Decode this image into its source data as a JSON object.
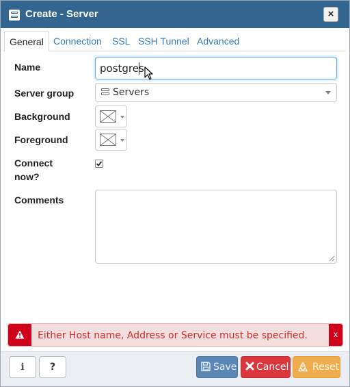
{
  "window": {
    "title": "Create - Server",
    "close_label": "×"
  },
  "tabs": [
    {
      "label": "General",
      "active": true
    },
    {
      "label": "Connection",
      "active": false
    },
    {
      "label": "SSL",
      "active": false
    },
    {
      "label": "SSH Tunnel",
      "active": false
    },
    {
      "label": "Advanced",
      "active": false
    }
  ],
  "form": {
    "name": {
      "label": "Name",
      "value": "postgres"
    },
    "server_group": {
      "label": "Server group",
      "selected": "Servers"
    },
    "background": {
      "label": "Background"
    },
    "foreground": {
      "label": "Foreground"
    },
    "connect_now": {
      "label_line1": "Connect",
      "label_line2": "now?",
      "checked": true
    },
    "comments": {
      "label": "Comments",
      "value": ""
    }
  },
  "error": {
    "message": "Either Host name, Address or Service must be specified.",
    "dismiss_label": "x"
  },
  "footer": {
    "info_label": "i",
    "help_label": "?",
    "save_label": "Save",
    "cancel_label": "Cancel",
    "reset_label": "Reset"
  },
  "colors": {
    "titlebar": "#326690",
    "link": "#337ab7",
    "error_accent": "#d0021b",
    "save": "#5a87b5",
    "cancel": "#d9363e",
    "reset": "#f0ad4e"
  }
}
